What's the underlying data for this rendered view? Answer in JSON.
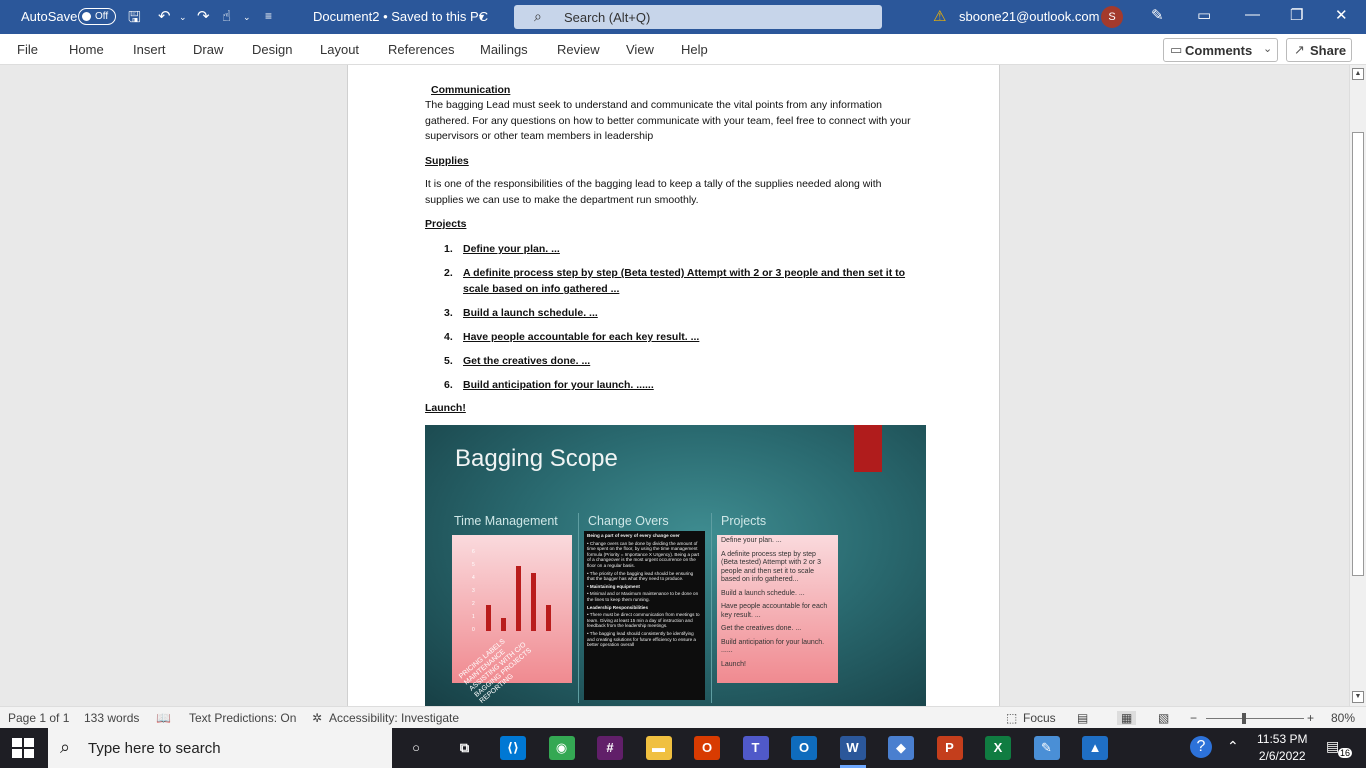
{
  "titlebar": {
    "autosave_label": "AutoSave",
    "autosave_state": "Off",
    "doc_title": "Document2 • Saved to this PC",
    "search_placeholder": "Search (Alt+Q)",
    "account": "sboone21@outlook.com",
    "avatar_initial": "S",
    "colors": {
      "bar": "#2b579a"
    }
  },
  "ribbon": {
    "tabs": [
      "File",
      "Home",
      "Insert",
      "Draw",
      "Design",
      "Layout",
      "References",
      "Mailings",
      "Review",
      "View",
      "Help"
    ],
    "comments_label": "Comments",
    "share_label": "Share"
  },
  "document": {
    "communication_heading": "Communication",
    "communication_body": "The bagging Lead must seek to understand and communicate the vital points from any information gathered. For any questions on how to better communicate with your team, feel free to connect with your supervisors or other team members in leadership",
    "supplies_heading": "Supplies",
    "supplies_body": "It is one of the responsibilities of the bagging lead to keep a tally of the supplies needed along with supplies we can use to make the department run smoothly.",
    "projects_heading": "Projects",
    "projects_list": [
      {
        "num": "1.",
        "text": "Define your plan. ..."
      },
      {
        "num": "2.",
        "text": "A definite process step by step (Beta tested) Attempt with 2 or 3 people and then set it to scale based on info gathered ..."
      },
      {
        "num": "3.",
        "text": "Build a launch schedule. ..."
      },
      {
        "num": "4.",
        "text": "Have people accountable for each key result. ..."
      },
      {
        "num": "5.",
        "text": "Get the creatives done. ..."
      },
      {
        "num": "6.",
        "text": "Build anticipation for your launch. ......"
      }
    ],
    "launch_heading": "Launch!",
    "slide": {
      "title": "Bagging Scope",
      "col_time": "Time Management",
      "col_change": "Change Overs",
      "col_projects": "Projects",
      "time_axis": [
        "6",
        "5",
        "4",
        "3",
        "2",
        "1",
        "0"
      ],
      "time_bar_values": [
        2,
        1,
        5,
        4.5,
        2
      ],
      "time_rotated_labels": [
        "PRICING LABELS",
        "MAINTENANCE",
        "ASSISTING WITH C/O",
        "BAGGING PROJECTS",
        "REPORTING"
      ],
      "change_text": [
        {
          "bold": true,
          "text": "Being a part of every of every change over"
        },
        {
          "bold": false,
          "text": "•  Change overs can be done by dividing the amount of time spent on the floor, by using the time management formula (Priority = Importance X Urgency). Being a part of a changeover is the most urgent occurrence on the floor on a regular basis."
        },
        {
          "bold": false,
          "text": "•  The priority of the bagging lead should be ensuring that the bagger has what they need to produce."
        },
        {
          "bold": true,
          "text": "•  Maintaining equipment"
        },
        {
          "bold": false,
          "text": "•  Minimal and or Maximum maintenance to be done on the lines to keep them running."
        },
        {
          "bold": true,
          "text": "Leadership Responsibilities"
        },
        {
          "bold": false,
          "text": "•  There must be direct communication from meetings to team. Giving at least 15 min a day of instruction and feedback from the leadership meetings."
        },
        {
          "bold": false,
          "text": "•  The bagging lead should consistently be identifying and creating solutions for future efficiency to ensure a better operation overall"
        }
      ],
      "projects_items": [
        "Define your plan. ...",
        "A definite process step by step (Beta tested) Attempt with 2 or 3 people and then set it to scale based on info gathered...",
        "Build a launch schedule. ...",
        "Have people accountable for each key result. ...",
        "Get the creatives done. ...",
        "Build anticipation for your launch. ......",
        "Launch!"
      ]
    }
  },
  "statusbar": {
    "page": "Page 1 of 1",
    "words": "133 words",
    "text_predictions": "Text Predictions: On",
    "accessibility": "Accessibility: Investigate",
    "focus": "Focus",
    "zoom": "80%",
    "zoom_level": 0.8
  },
  "taskbar": {
    "search_placeholder": "Type here to search",
    "time": "11:53 PM",
    "date": "2/6/2022",
    "notification_count": "16",
    "apps": [
      {
        "name": "cortana",
        "label": "○",
        "color": "#1e1e24"
      },
      {
        "name": "task-view",
        "label": "⧉",
        "color": "#1e1e24"
      },
      {
        "name": "vscode",
        "label": "⟨⟩",
        "color": "#0078d4"
      },
      {
        "name": "chrome",
        "label": "◉",
        "color": "#34a853"
      },
      {
        "name": "slack",
        "label": "#",
        "color": "#611f69"
      },
      {
        "name": "file-explorer",
        "label": "▬",
        "color": "#f0c040"
      },
      {
        "name": "office",
        "label": "O",
        "color": "#d83b01"
      },
      {
        "name": "teams",
        "label": "T",
        "color": "#5059c9"
      },
      {
        "name": "outlook",
        "label": "O",
        "color": "#0f6cbd"
      },
      {
        "name": "word",
        "label": "W",
        "color": "#2b579a"
      },
      {
        "name": "git",
        "label": "◆",
        "color": "#4a7fcf"
      },
      {
        "name": "powerpoint",
        "label": "P",
        "color": "#c43e1c"
      },
      {
        "name": "excel",
        "label": "X",
        "color": "#107c41"
      },
      {
        "name": "paint",
        "label": "✎",
        "color": "#4a8fd6"
      },
      {
        "name": "photos",
        "label": "▲",
        "color": "#1f6fc5"
      }
    ]
  }
}
